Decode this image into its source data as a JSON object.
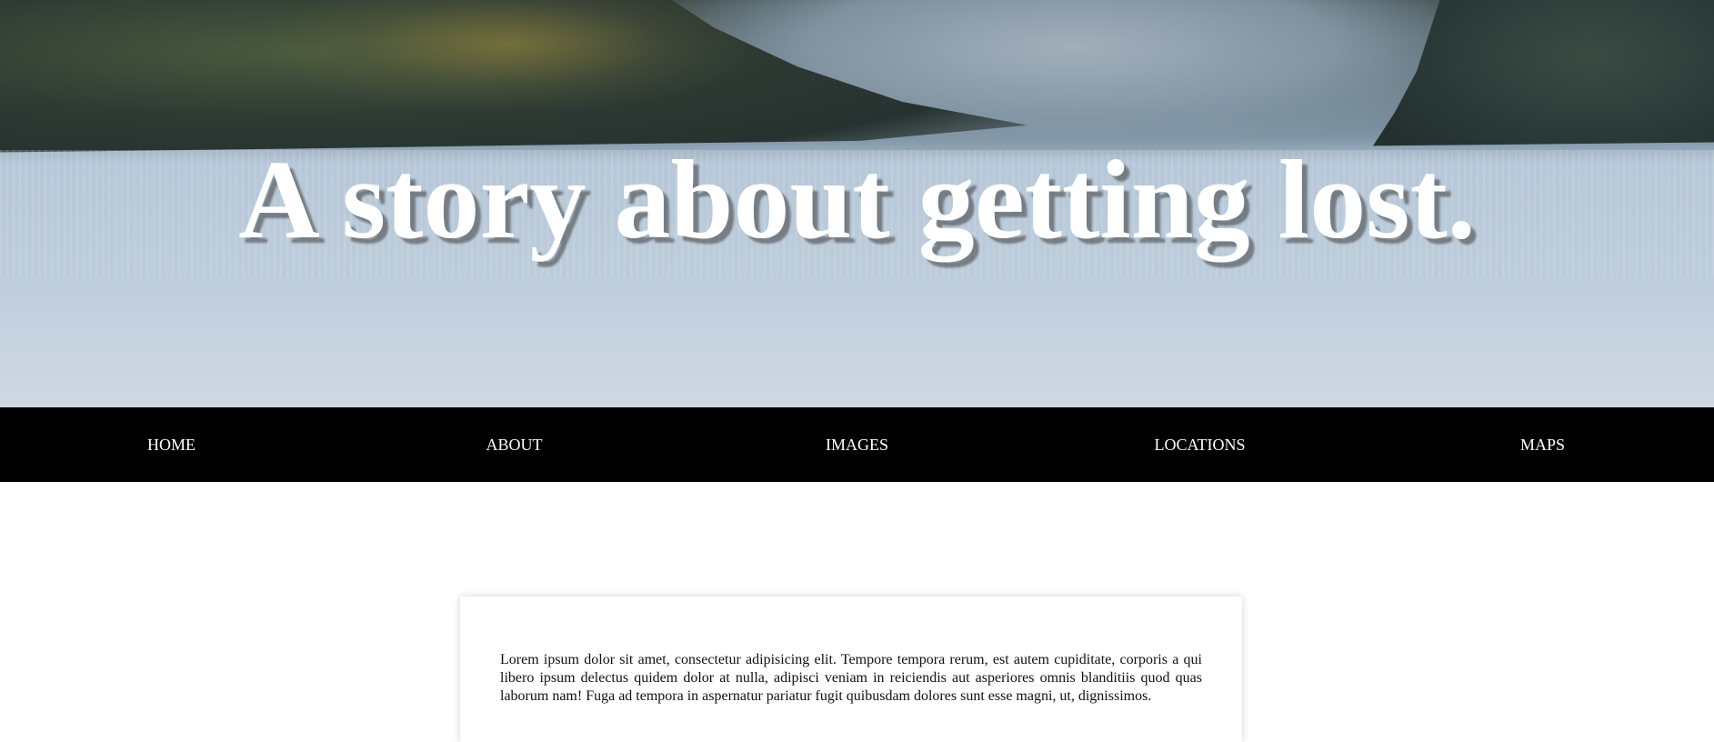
{
  "hero": {
    "title": "A story about getting lost."
  },
  "nav": {
    "items": [
      {
        "label": "HOME"
      },
      {
        "label": "ABOUT"
      },
      {
        "label": "IMAGES"
      },
      {
        "label": "LOCATIONS"
      },
      {
        "label": "MAPS"
      }
    ]
  },
  "content": {
    "paragraph": "Lorem ipsum dolor sit amet, consectetur adipisicing elit. Tempore tempora rerum, est autem cupiditate, corporis a qui libero ipsum delectus quidem dolor at nulla, adipisci veniam in reiciendis aut asperiores omnis blanditiis quod quas laborum nam! Fuga ad tempora in aspernatur pariatur fugit quibusdam dolores sunt esse magni, ut, dignissimos."
  },
  "colors": {
    "nav_background": "#000000",
    "nav_text": "#ffffff",
    "hero_title": "#ffffff",
    "page_background": "#ffffff"
  }
}
